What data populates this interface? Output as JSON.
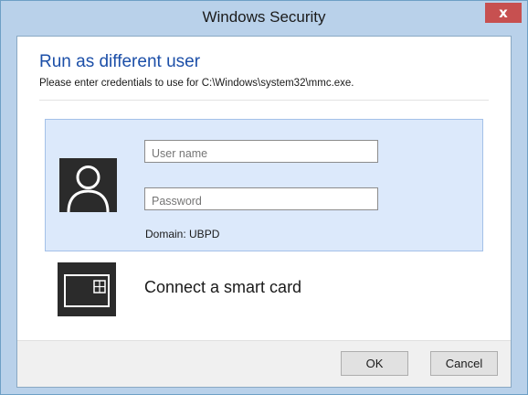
{
  "window": {
    "title": "Windows Security",
    "close_symbol": "x"
  },
  "dialog": {
    "heading": "Run as different user",
    "subheading": "Please enter credentials to use for C:\\Windows\\system32\\mmc.exe."
  },
  "credentials": {
    "username_placeholder": "User name",
    "password_placeholder": "Password",
    "domain_label": "Domain: UBPD",
    "avatar_icon": "user-avatar-icon"
  },
  "smart_card": {
    "label": "Connect a smart card",
    "icon": "smart-card-icon"
  },
  "buttons": {
    "ok": "OK",
    "cancel": "Cancel"
  },
  "colors": {
    "title_bar": "#b9d1ea",
    "heading": "#1c4fa8",
    "selected_tile": "#dce9fb",
    "close_button": "#c75050"
  }
}
